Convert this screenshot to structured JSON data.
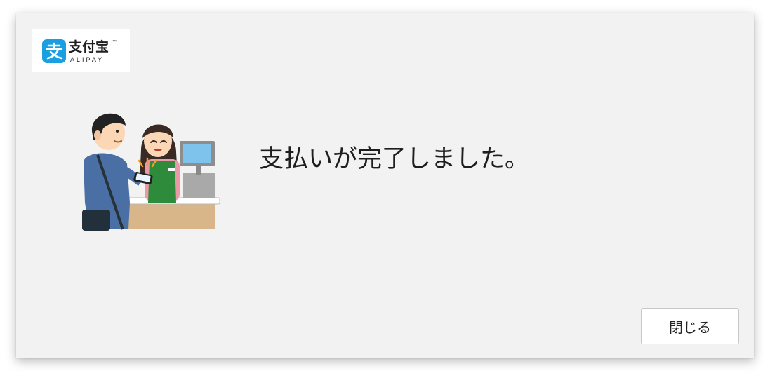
{
  "logo": {
    "cn": "支付宝",
    "tm": "™",
    "en": "ALIPAY",
    "icon": "alipay-logo-icon",
    "brand_color": "#1a9fe0"
  },
  "illustration": {
    "icon": "cashier-payment-illustration"
  },
  "message": "支払いが完了しました。",
  "close_button": {
    "label": "閉じる"
  },
  "colors": {
    "dialog_background": "#f2f2f2",
    "button_background": "#ffffff",
    "button_border": "#c8c8c8"
  }
}
